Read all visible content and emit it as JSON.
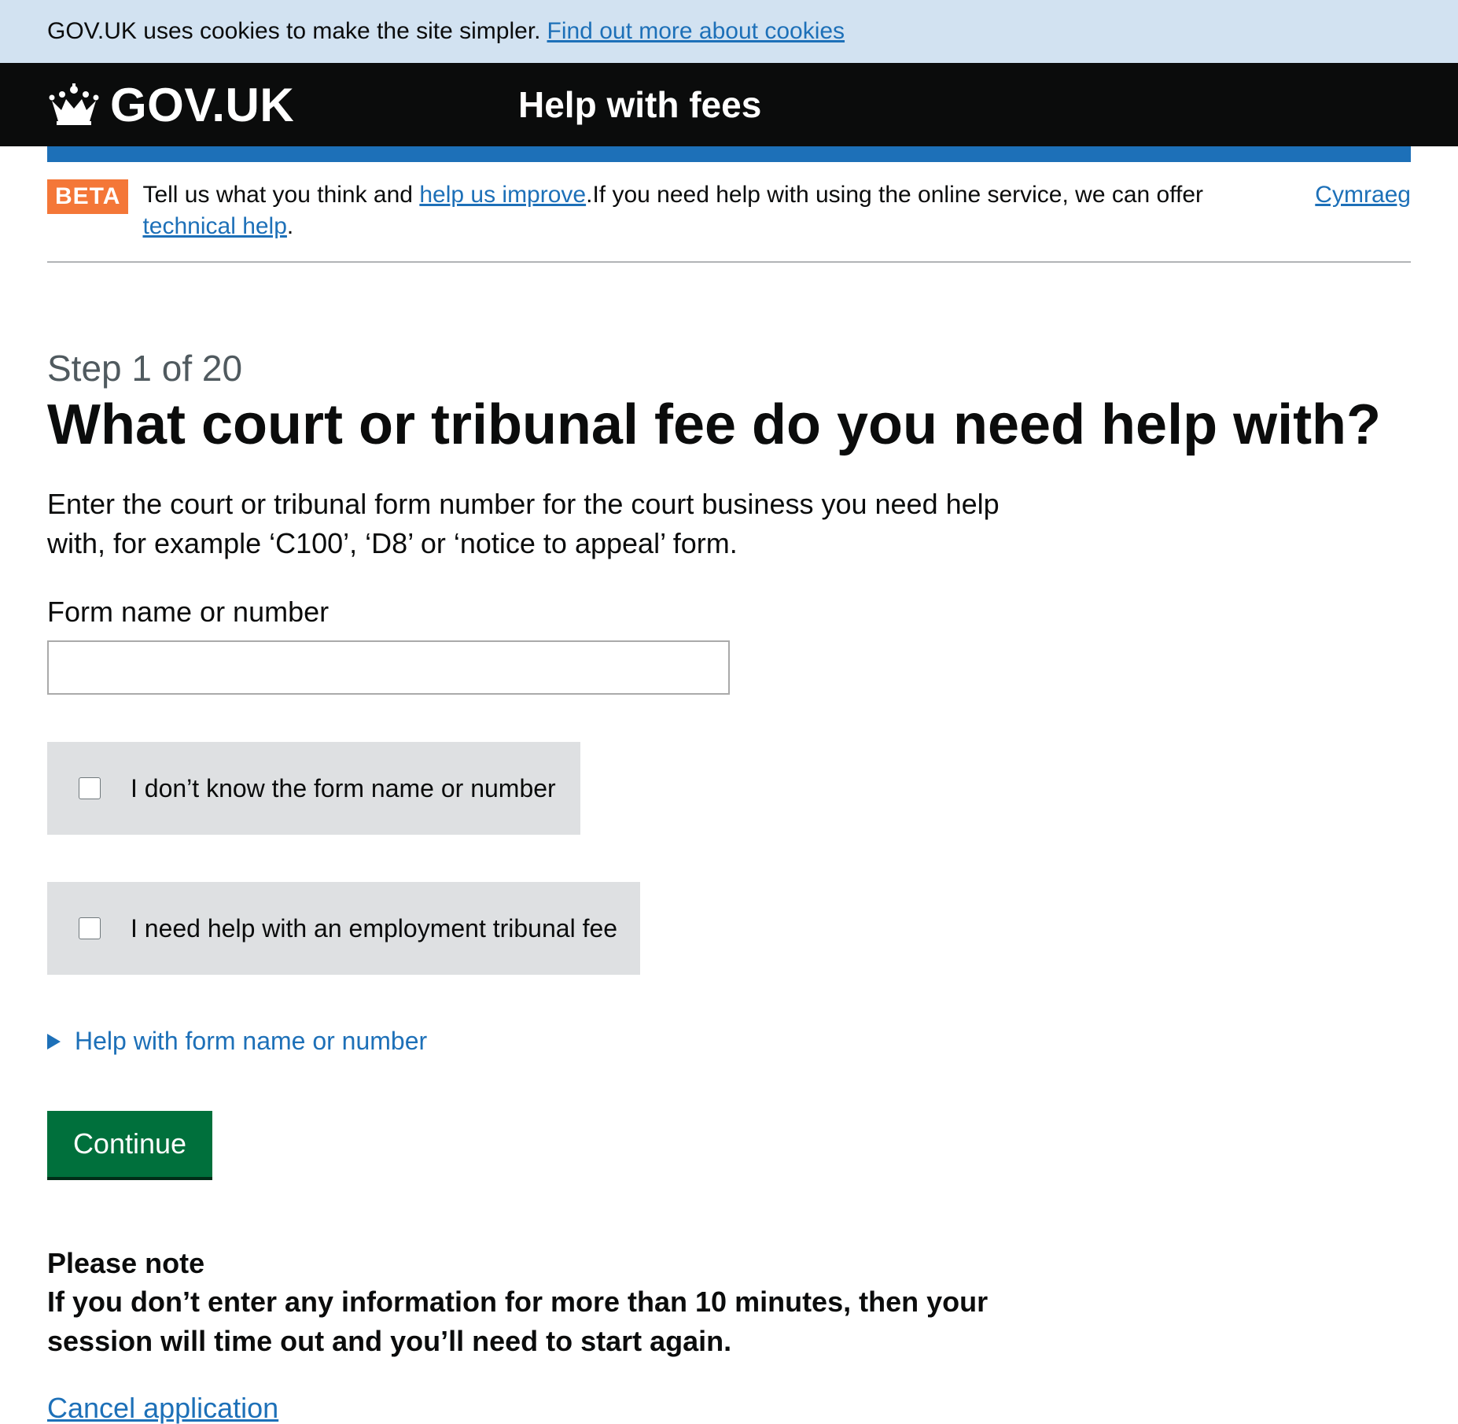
{
  "cookie_banner": {
    "text": "GOV.UK uses cookies to make the site simpler.",
    "link": "Find out more about cookies"
  },
  "header": {
    "logo_icon": "crown-icon",
    "logo_text": "GOV.UK",
    "service_name": "Help with fees"
  },
  "colors": {
    "header_bg": "#0b0c0c",
    "bar_blue": "#1d70b8",
    "beta_orange": "#f47738",
    "button_green": "#00703c",
    "cookie_bg": "#d2e2f1",
    "checkbox_bg": "#dee0e2"
  },
  "phase_banner": {
    "tag": "BETA",
    "text_before": "Tell us what you think and ",
    "feedback_link": "help us improve",
    "text_middle": ".If you need help with using the online service, we can offer ",
    "tech_help_link": "technical help",
    "text_after": ".",
    "language_link": "Cymraeg"
  },
  "main": {
    "step": "Step 1 of 20",
    "heading": "What court or tribunal fee do you need help with?",
    "intro": "Enter the court or tribunal form number for the court business you need help with, for example ‘C100’, ‘D8’ or ‘notice to appeal’ form.",
    "form_label": "Form name or number",
    "form_value": "",
    "checkboxes": [
      {
        "label": "I don’t know the form name or number",
        "checked": false
      },
      {
        "label": "I need help with an employment tribunal fee",
        "checked": false
      }
    ],
    "details_summary": "Help with form name or number",
    "continue_button": "Continue",
    "note_title": "Please note",
    "note_body": "If you don’t enter any information for more than 10 minutes, then your session will time out and you’ll need to start again.",
    "cancel_link": "Cancel application"
  }
}
